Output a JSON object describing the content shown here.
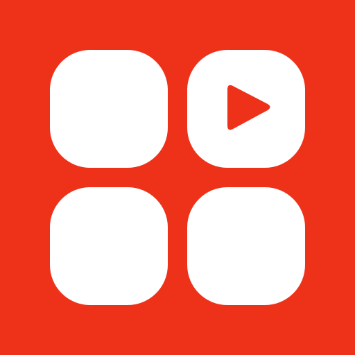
{
  "app_icon": {
    "icon_name": "video-grid-app-icon",
    "background_color": "#EE3219",
    "tile_color": "#FFFFFF",
    "play_color": "#EE3219",
    "tiles": [
      {
        "name": "grid-tile-top-left",
        "has_play": false
      },
      {
        "name": "grid-tile-top-right",
        "has_play": true
      },
      {
        "name": "grid-tile-bottom-left",
        "has_play": false
      },
      {
        "name": "grid-tile-bottom-right",
        "has_play": false
      }
    ]
  }
}
